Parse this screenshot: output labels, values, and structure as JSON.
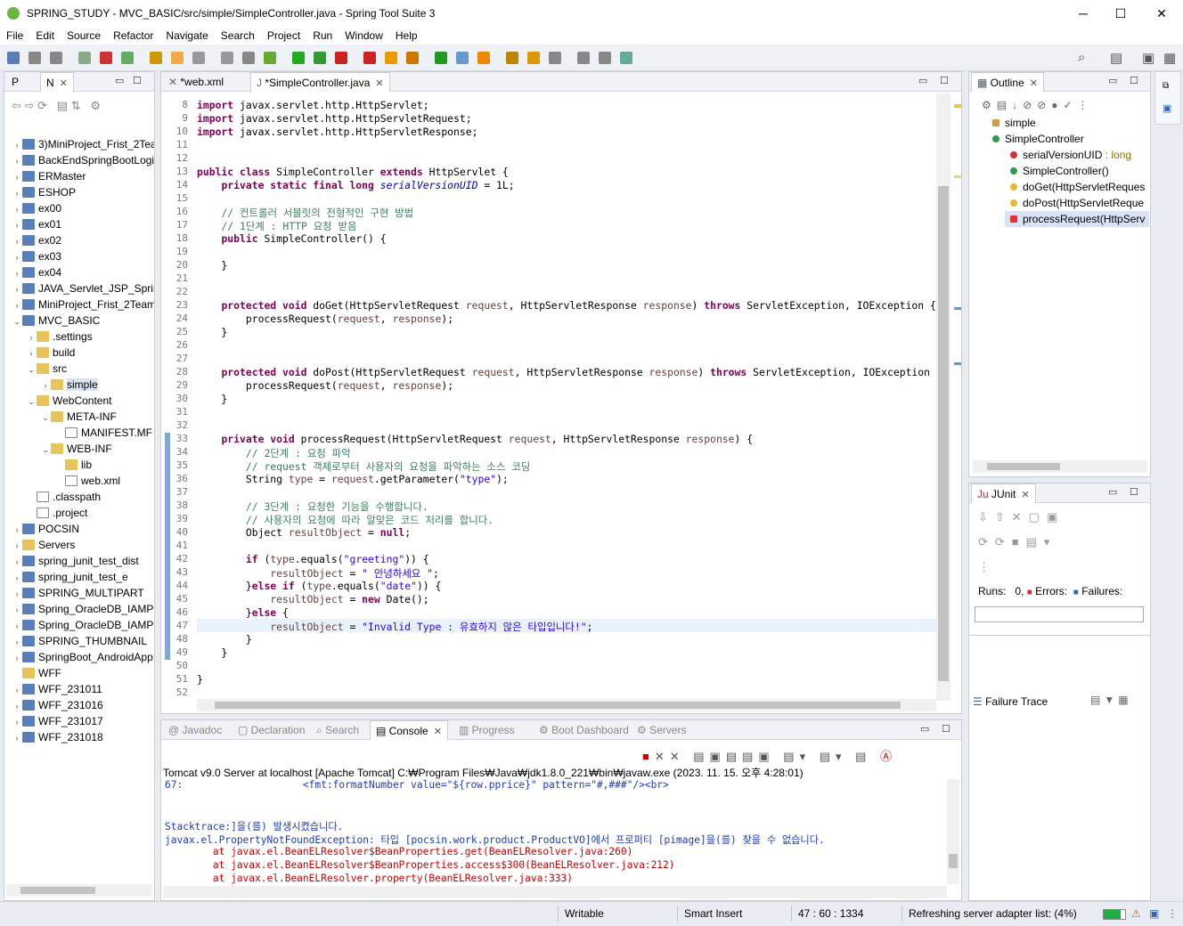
{
  "window": {
    "title": "SPRING_STUDY - MVC_BASIC/src/simple/SimpleController.java - Spring Tool Suite 3",
    "min": "─",
    "max": "☐",
    "close": "✕"
  },
  "menu": [
    "File",
    "Edit",
    "Source",
    "Refactor",
    "Navigate",
    "Search",
    "Project",
    "Run",
    "Window",
    "Help"
  ],
  "left_panel": {
    "tabs": [
      {
        "label": "P"
      },
      {
        "label": "N"
      }
    ],
    "items": [
      {
        "label": "3)MiniProject_Frist_2Tea",
        "depth": 0,
        "icon": "project-icon",
        "tw": "›"
      },
      {
        "label": "BackEndSpringBootLogi",
        "depth": 0,
        "icon": "project-icon",
        "tw": "›"
      },
      {
        "label": "ERMaster",
        "depth": 0,
        "icon": "project-icon",
        "tw": "›"
      },
      {
        "label": "ESHOP",
        "depth": 0,
        "icon": "project-icon",
        "tw": "›"
      },
      {
        "label": "ex00",
        "depth": 0,
        "icon": "project-icon",
        "tw": "›"
      },
      {
        "label": "ex01",
        "depth": 0,
        "icon": "project-icon",
        "tw": "›"
      },
      {
        "label": "ex02",
        "depth": 0,
        "icon": "project-icon",
        "tw": "›"
      },
      {
        "label": "ex03",
        "depth": 0,
        "icon": "project-icon",
        "tw": "›"
      },
      {
        "label": "ex04",
        "depth": 0,
        "icon": "project-icon",
        "tw": "›"
      },
      {
        "label": "JAVA_Servlet_JSP_Spring",
        "depth": 0,
        "icon": "project-icon",
        "tw": "›"
      },
      {
        "label": "MiniProject_Frist_2Team",
        "depth": 0,
        "icon": "project-icon",
        "tw": "›"
      },
      {
        "label": "MVC_BASIC",
        "depth": 0,
        "icon": "project-icon",
        "tw": "⌄"
      },
      {
        "label": ".settings",
        "depth": 1,
        "icon": "folder-icon",
        "tw": "›"
      },
      {
        "label": "build",
        "depth": 1,
        "icon": "folder-icon",
        "tw": "›"
      },
      {
        "label": "src",
        "depth": 1,
        "icon": "folder-icon",
        "tw": "⌄"
      },
      {
        "label": "simple",
        "depth": 2,
        "icon": "folder-icon",
        "tw": "›",
        "selected": true
      },
      {
        "label": "WebContent",
        "depth": 1,
        "icon": "folder-icon",
        "tw": "⌄"
      },
      {
        "label": "META-INF",
        "depth": 2,
        "icon": "folder-icon",
        "tw": "⌄"
      },
      {
        "label": "MANIFEST.MF",
        "depth": 3,
        "icon": "file-icon",
        "tw": ""
      },
      {
        "label": "WEB-INF",
        "depth": 2,
        "icon": "folder-icon",
        "tw": "⌄"
      },
      {
        "label": "lib",
        "depth": 3,
        "icon": "folder-icon",
        "tw": ""
      },
      {
        "label": "web.xml",
        "depth": 3,
        "icon": "file-icon",
        "tw": ""
      },
      {
        "label": ".classpath",
        "depth": 1,
        "icon": "file-icon",
        "tw": ""
      },
      {
        "label": ".project",
        "depth": 1,
        "icon": "file-icon",
        "tw": ""
      },
      {
        "label": "POCSIN",
        "depth": 0,
        "icon": "project-icon",
        "tw": "›"
      },
      {
        "label": "Servers",
        "depth": 0,
        "icon": "folder-icon",
        "tw": "›"
      },
      {
        "label": "spring_junit_test_dist",
        "depth": 0,
        "icon": "project-icon",
        "tw": "›"
      },
      {
        "label": "spring_junit_test_e",
        "depth": 0,
        "icon": "project-icon",
        "tw": "›"
      },
      {
        "label": "SPRING_MULTIPART",
        "depth": 0,
        "icon": "project-icon",
        "tw": "›"
      },
      {
        "label": "Spring_OracleDB_IAMPO",
        "depth": 0,
        "icon": "project-icon",
        "tw": "›"
      },
      {
        "label": "Spring_OracleDB_IAMPO",
        "depth": 0,
        "icon": "project-icon",
        "tw": "›"
      },
      {
        "label": "SPRING_THUMBNAIL",
        "depth": 0,
        "icon": "project-icon",
        "tw": "›"
      },
      {
        "label": "SpringBoot_AndroidApp",
        "depth": 0,
        "icon": "project-icon",
        "tw": "›"
      },
      {
        "label": "WFF",
        "depth": 0,
        "icon": "folder-icon",
        "tw": ""
      },
      {
        "label": "WFF_231011",
        "depth": 0,
        "icon": "project-icon",
        "tw": "›"
      },
      {
        "label": "WFF_231016",
        "depth": 0,
        "icon": "project-icon",
        "tw": "›"
      },
      {
        "label": "WFF_231017",
        "depth": 0,
        "icon": "project-icon",
        "tw": "›"
      },
      {
        "label": "WFF_231018",
        "depth": 0,
        "icon": "project-icon",
        "tw": "›"
      }
    ]
  },
  "editor": {
    "tabs": [
      {
        "label": "*web.xml",
        "active": false
      },
      {
        "label": "*SimpleController.java",
        "active": true
      }
    ],
    "lines": [
      {
        "n": "8",
        "h": "<span class='kw'>import</span> javax.servlet.http.HttpServlet;"
      },
      {
        "n": "9",
        "h": "<span class='kw'>import</span> javax.servlet.http.HttpServletRequest;"
      },
      {
        "n": "10",
        "h": "<span class='kw'>import</span> javax.servlet.http.HttpServletResponse;"
      },
      {
        "n": "11",
        "h": ""
      },
      {
        "n": "12",
        "h": ""
      },
      {
        "n": "13",
        "h": "<span class='kw'>public class</span> SimpleController <span class='kw'>extends</span> HttpServlet {"
      },
      {
        "n": "14",
        "h": "    <span class='kw'>private static final long</span> <span class='fi'>serialVersionUID</span> = 1L;"
      },
      {
        "n": "15",
        "h": ""
      },
      {
        "n": "16",
        "h": "    <span class='cm'>// 컨트롤러 서블릿의 전형적인 구현 방법</span>"
      },
      {
        "n": "17",
        "h": "    <span class='cm'>// 1단계 : HTTP 요청 받음</span>"
      },
      {
        "n": "18",
        "h": "    <span class='kw'>public</span> SimpleController() {"
      },
      {
        "n": "19",
        "h": ""
      },
      {
        "n": "20",
        "h": "    }"
      },
      {
        "n": "21",
        "h": ""
      },
      {
        "n": "22",
        "h": ""
      },
      {
        "n": "23",
        "h": "    <span class='kw'>protected void</span> doGet(HttpServletRequest <span class='pr'>request</span>, HttpServletResponse <span class='pr'>response</span>) <span class='kw'>throws</span> ServletException, IOException {"
      },
      {
        "n": "24",
        "h": "        processRequest(<span class='pr'>request</span>, <span class='pr'>response</span>);"
      },
      {
        "n": "25",
        "h": "    }"
      },
      {
        "n": "26",
        "h": ""
      },
      {
        "n": "27",
        "h": ""
      },
      {
        "n": "28",
        "h": "    <span class='kw'>protected void</span> doPost(HttpServletRequest <span class='pr'>request</span>, HttpServletResponse <span class='pr'>response</span>) <span class='kw'>throws</span> ServletException, IOException {"
      },
      {
        "n": "29",
        "h": "        processRequest(<span class='pr'>request</span>, <span class='pr'>response</span>);"
      },
      {
        "n": "30",
        "h": "    }"
      },
      {
        "n": "31",
        "h": ""
      },
      {
        "n": "32",
        "h": ""
      },
      {
        "n": "33",
        "h": "    <span class='kw'>private void</span> processRequest(HttpServletRequest <span class='pr'>request</span>, HttpServletResponse <span class='pr'>response</span>) {"
      },
      {
        "n": "34",
        "h": "        <span class='cm'>// 2단계 : 요청 파악</span>"
      },
      {
        "n": "35",
        "h": "        <span class='cm'>// request 객체로부터 사용자의 요청을 파악하는 소스 코딩</span>"
      },
      {
        "n": "36",
        "h": "        String <span class='pr'>type</span> = <span class='pr'>request</span>.getParameter(<span class='st'>\"type\"</span>);"
      },
      {
        "n": "37",
        "h": ""
      },
      {
        "n": "38",
        "h": "        <span class='cm'>// 3단계 : 요청한 기능을 수행합니다.</span>"
      },
      {
        "n": "39",
        "h": "        <span class='cm'>// 사용자의 요청에 따라 알맞은 코드 처리를 합니다.</span>"
      },
      {
        "n": "40",
        "h": "        Object <span class='pr'>resultObject</span> = <span class='kw'>null</span>;"
      },
      {
        "n": "41",
        "h": ""
      },
      {
        "n": "42",
        "h": "        <span class='kw'>if</span> (<span class='pr'>type</span>.equals(<span class='st'>\"greeting\"</span>)) {"
      },
      {
        "n": "43",
        "h": "            <span class='pr'>resultObject</span> = <span class='st'>\" 안녕하세요 \"</span>;"
      },
      {
        "n": "44",
        "h": "        }<span class='kw'>else if</span> (<span class='pr'>type</span>.equals(<span class='st'>\"date\"</span>)) {"
      },
      {
        "n": "45",
        "h": "            <span class='pr'>resultObject</span> = <span class='kw'>new</span> Date();"
      },
      {
        "n": "46",
        "h": "        }<span class='kw'>else</span> {"
      },
      {
        "n": "47",
        "h": "            <span class='pr'>resultObject</span> = <span class='st'>\"Invalid Type : 유효하지 않은 타입입니다!\"</span>;"
      },
      {
        "n": "48",
        "h": "        }"
      },
      {
        "n": "49",
        "h": "    }"
      },
      {
        "n": "50",
        "h": ""
      },
      {
        "n": "51",
        "h": "}"
      },
      {
        "n": "52",
        "h": ""
      }
    ]
  },
  "outline": {
    "tab": "Outline",
    "items": [
      {
        "label": "simple",
        "depth": 0,
        "icon": "package-icon",
        "suffix": ""
      },
      {
        "label": "SimpleController",
        "depth": 0,
        "icon": "class-icon",
        "suffix": ""
      },
      {
        "label": "serialVersionUID",
        "depth": 1,
        "icon": "field-icon",
        "suffix": " : long"
      },
      {
        "label": "SimpleController()",
        "depth": 1,
        "icon": "constructor-icon",
        "suffix": ""
      },
      {
        "label": "doGet(HttpServletReques",
        "depth": 1,
        "icon": "method-protected-icon",
        "suffix": ""
      },
      {
        "label": "doPost(HttpServletReque",
        "depth": 1,
        "icon": "method-protected-icon",
        "suffix": ""
      },
      {
        "label": "processRequest(HttpServ",
        "depth": 1,
        "icon": "method-private-icon",
        "suffix": "",
        "selected": true
      }
    ]
  },
  "junit": {
    "tab": "JUnit",
    "runs_label": "Runs:",
    "runs_value": "0,",
    "errors_label": "Errors:",
    "failures_label": "Failures:",
    "failure_trace": "Failure Trace"
  },
  "bottom": {
    "tabs": [
      {
        "label": "Javadoc"
      },
      {
        "label": "Declaration"
      },
      {
        "label": "Search"
      },
      {
        "label": "Console",
        "active": true
      },
      {
        "label": "Progress"
      },
      {
        "label": "Boot Dashboard"
      },
      {
        "label": "Servers"
      }
    ],
    "console_header": "Tomcat v9.0 Server at localhost [Apache Tomcat] C:₩Program Files₩Java₩jdk1.8.0_221₩bin₩javaw.exe  (2023. 11. 15. 오후 4:28:01)",
    "console_lines": [
      {
        "text": "67:                    <fmt:formatNumber value=\"${row.pprice}\" pattern=\"#,###\"/><br>",
        "cls": "blue"
      },
      {
        "text": "",
        "cls": ""
      },
      {
        "text": "",
        "cls": ""
      },
      {
        "text": "Stacktrace:]을(를) 발생시켰습니다.",
        "cls": "blue"
      },
      {
        "text": "javax.el.PropertyNotFoundException: 타입 [pocsin.work.product.ProductVO]에서 프로퍼티 [pimage]을(를) 찾을 수 없습니다.",
        "cls": "blue"
      },
      {
        "text": "        at javax.el.BeanELResolver$BeanProperties.get(BeanELResolver.java:260)",
        "cls": "red"
      },
      {
        "text": "        at javax.el.BeanELResolver$BeanProperties.access$300(BeanELResolver.java:212)",
        "cls": "red"
      },
      {
        "text": "        at javax.el.BeanELResolver.property(BeanELResolver.java:333)",
        "cls": "red"
      }
    ]
  },
  "status": {
    "writable": "Writable",
    "insert": "Smart Insert",
    "position": "47 : 60 : 1334",
    "task": "Refreshing server adapter list: (4%)",
    "task_progress": 0.04
  }
}
